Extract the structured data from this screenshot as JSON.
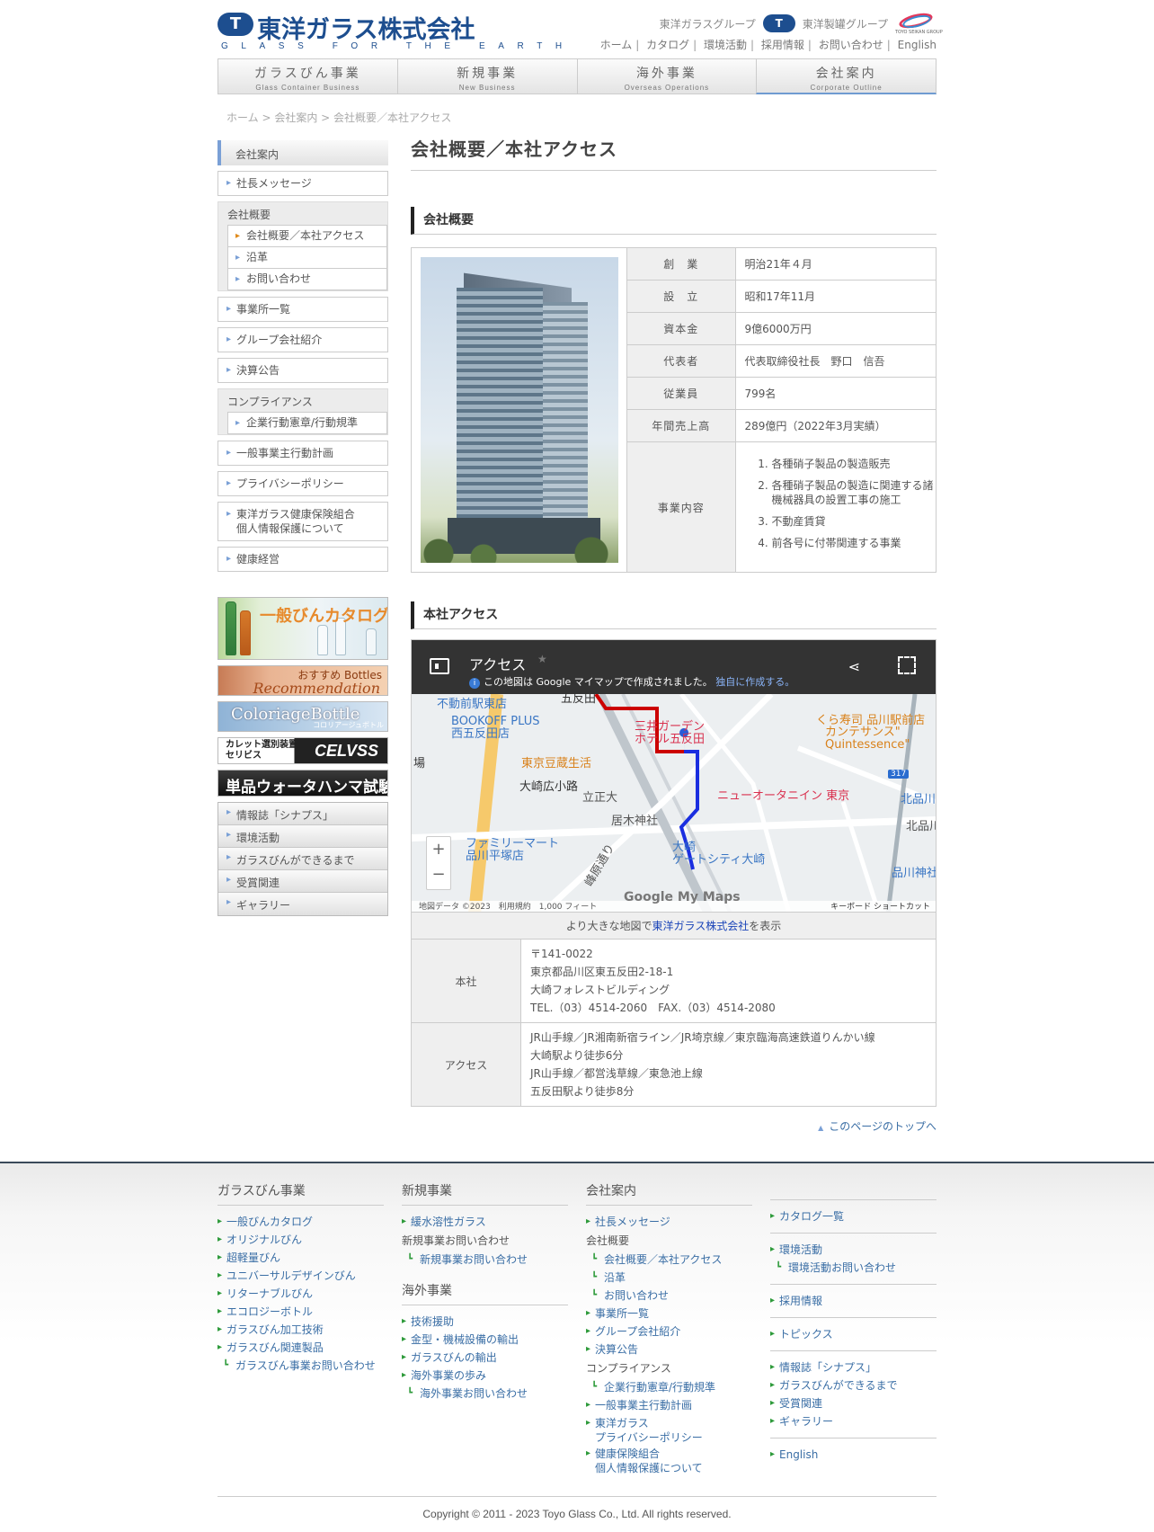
{
  "header": {
    "logo_mark": "T",
    "company_name": "東洋ガラス株式会社",
    "tagline": "GLASS FOR THE EARTH",
    "group1": "東洋ガラスグループ",
    "group2": "東洋製罐グループ",
    "group2_caption": "TOYO SEIKAN GROUP",
    "topnav": [
      "ホーム",
      "カタログ",
      "環境活動",
      "採用情報",
      "お問い合わせ",
      "English"
    ]
  },
  "gnav": [
    {
      "label": "ガラスびん事業",
      "sub": "Glass Container Business"
    },
    {
      "label": "新規事業",
      "sub": "New Business"
    },
    {
      "label": "海外事業",
      "sub": "Overseas Operations"
    },
    {
      "label": "会社案内",
      "sub": "Corporate Outline"
    }
  ],
  "breadcrumb": [
    "ホーム",
    "会社案内",
    "会社概要／本社アクセス"
  ],
  "sidebar": {
    "head": "会社案内",
    "item_message": "社長メッセージ",
    "group_overview": "会社概要",
    "sub_overview": [
      "会社概要／本社アクセス",
      "沿革",
      "お問い合わせ"
    ],
    "items_mid": [
      "事業所一覧",
      "グループ会社紹介",
      "決算公告"
    ],
    "group_compliance": "コンプライアンス",
    "sub_compliance": [
      "企業行動憲章/行動規準"
    ],
    "items_low": [
      "一般事業主行動計画",
      "プライバシーポリシー",
      "東洋ガラス健康保険組合\n個人情報保護について",
      "健康経営"
    ],
    "banners": {
      "catalog": "一般びんカタログ",
      "reco_top": "おすすめ Bottles",
      "reco_bottom": "Recommendation",
      "color_top": "ColoriageBottle",
      "color_bottom": "コロリアージュボトル",
      "cullet_left": "カレット選別装置\nセリビス",
      "cullet_right": "CELVSS",
      "water": "単品ウォータハンマ試験機"
    },
    "links": [
      "情報誌「シナプス」",
      "環境活動",
      "ガラスびんができるまで",
      "受賞関連",
      "ギャラリー"
    ]
  },
  "main": {
    "title": "会社概要／本社アクセス",
    "section_overview": "会社概要",
    "info_rows": [
      {
        "label": "創　業",
        "value": "明治21年４月"
      },
      {
        "label": "設　立",
        "value": "昭和17年11月"
      },
      {
        "label": "資本金",
        "value": "9億6000万円"
      },
      {
        "label": "代表者",
        "value": "代表取締役社長　野口　信吾"
      },
      {
        "label": "従業員",
        "value": "799名"
      },
      {
        "label": "年間売上高",
        "value": "289億円（2022年3月実績）"
      }
    ],
    "business_label": "事業内容",
    "business_items": [
      "各種硝子製品の製造販売",
      "各種硝子製品の製造に関連する諸機械器具の設置工事の施工",
      "不動産賃貸",
      "前各号に付帯関連する事業"
    ],
    "section_access": "本社アクセス",
    "map": {
      "title": "アクセス",
      "note": "この地図は Google マイマップで作成されました。",
      "note_link": "独自に作成する。",
      "labels": [
        "不動前駅東店",
        "BOOKOFF PLUS\n西五反田店",
        "東京豆蔵生活",
        "大崎広小路",
        "立正大",
        "居木神社",
        "ファミリーマート\n品川平塚店",
        "三井ガーデン\nホテル五反田",
        "ニューオータニイン 東京",
        "大崎\nゲートシティ大崎",
        "くら寿司 品川駅前店",
        "カンテサンス\"\nQuintessence\"",
        "北品川",
        "北品川",
        "品川神社",
        "五反田",
        "場",
        "峰原通り",
        "317"
      ],
      "footer": "地図データ ©2023　利用規約　1,000 フィート",
      "keyboard": "キーボード ショートカット",
      "brand": "Google My Maps"
    },
    "map_link_prefix": "より大きな地図で",
    "map_link_text": "東洋ガラス株式会社",
    "map_link_suffix": "を表示",
    "hq_label": "本社",
    "hq_lines": [
      "〒141-0022",
      "東京都品川区東五反田2-18-1",
      "大崎フォレストビルディング",
      "TEL.（03）4514-2060　FAX.（03）4514-2080"
    ],
    "access_label": "アクセス",
    "access_lines": [
      "JR山手線／JR湘南新宿ライン／JR埼京線／東京臨海高速鉄道りんかい線",
      "大崎駅より徒歩6分",
      "JR山手線／都営浅草線／東急池上線",
      "五反田駅より徒歩8分"
    ],
    "to_top": "このページのトップへ"
  },
  "footer": {
    "col1": {
      "title": "ガラスびん事業",
      "links": [
        "一般びんカタログ",
        "オリジナルびん",
        "超軽量びん",
        "ユニバーサルデザインびん",
        "リターナブルびん",
        "エコロジーボトル",
        "ガラスびん加工技術",
        "ガラスびん関連製品"
      ],
      "sub": "ガラスびん事業お問い合わせ"
    },
    "col2": {
      "title": "新規事業",
      "links": [
        "緩水溶性ガラス"
      ],
      "head2": "新規事業お問い合わせ",
      "sub2": "新規事業お問い合わせ",
      "title2": "海外事業",
      "links2": [
        "技術援助",
        "金型・機械設備の輸出",
        "ガラスびんの輸出",
        "海外事業の歩み"
      ],
      "sub3": "海外事業お問い合わせ"
    },
    "col3": {
      "title": "会社案内",
      "link1": "社長メッセージ",
      "head1": "会社概要",
      "subs1": [
        "会社概要／本社アクセス",
        "沿革",
        "お問い合わせ"
      ],
      "links2": [
        "事業所一覧",
        "グループ会社紹介",
        "決算公告"
      ],
      "head2": "コンプライアンス",
      "subs2": [
        "企業行動憲章/行動規準"
      ],
      "links3": [
        "一般事業主行動計画",
        "東洋ガラス\nプライバシーポリシー",
        "健康保険組合\n個人情報保護について"
      ]
    },
    "col4": {
      "link_catalog": "カタログ一覧",
      "link_env": "環境活動",
      "sub_env": "環境活動お問い合わせ",
      "link_recruit": "採用情報",
      "link_topics": "トピックス",
      "links_misc": [
        "情報誌「シナプス」",
        "ガラスびんができるまで",
        "受賞関連",
        "ギャラリー"
      ],
      "link_english": "English"
    },
    "copyright": "Copyright © 2011 - 2023 Toyo Glass Co., Ltd. All rights reserved."
  },
  "colors": {
    "brand": "#1d4e8f",
    "link": "#3a6ea5",
    "route_red": "#cc0000",
    "route_blue": "#1a2ee0"
  }
}
